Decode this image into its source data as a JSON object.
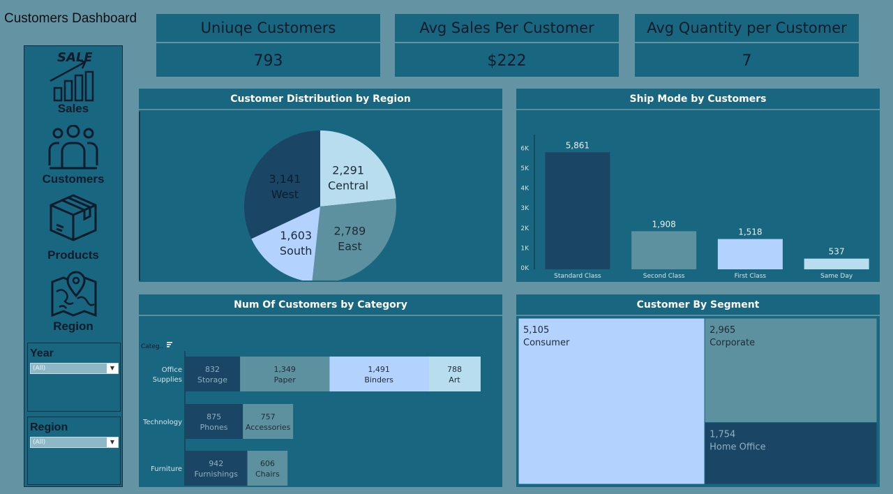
{
  "title": "Customers Dashboard",
  "kpis": [
    {
      "label": "Uniuqe Customers",
      "value": "793"
    },
    {
      "label": "Avg Sales Per Customer",
      "value": "$222"
    },
    {
      "label": "Avg Quantity per Customer",
      "value": "7"
    }
  ],
  "nav": {
    "sales_badge": "SALE",
    "items": [
      "Sales",
      "Customers",
      "Products",
      "Region"
    ]
  },
  "filters": [
    {
      "label": "Year",
      "value": "(All)"
    },
    {
      "label": "Region",
      "value": "(All)"
    }
  ],
  "colors": {
    "dark": "#1b4565",
    "mid": "#5e91a0",
    "light": "#b7ddee",
    "pale": "#b3d2fe",
    "panel": "#18667f"
  },
  "charts": {
    "region": {
      "title": "Customer Distribution by Region",
      "chart_data": {
        "type": "pie",
        "slices": [
          {
            "label": "Central",
            "value": 2291,
            "display": "2,291",
            "color": "#b7ddee"
          },
          {
            "label": "East",
            "value": 2789,
            "display": "2,789",
            "color": "#5e91a0"
          },
          {
            "label": "South",
            "value": 1603,
            "display": "1,603",
            "color": "#b3d2fe"
          },
          {
            "label": "West",
            "value": 3141,
            "display": "3,141",
            "color": "#1b4565"
          }
        ]
      }
    },
    "shipmode": {
      "title": "Ship Mode by Customers",
      "chart_data": {
        "type": "bar",
        "categories": [
          "Standard Class",
          "Second Class",
          "First Class",
          "Same Day"
        ],
        "values": [
          5861,
          1908,
          1518,
          537
        ],
        "labels": [
          "5,861",
          "1,908",
          "1,518",
          "537"
        ],
        "colors": [
          "#1b4565",
          "#5e91a0",
          "#b3d2fe",
          "#b7ddee"
        ],
        "yticks": [
          "0K",
          "1K",
          "2K",
          "3K",
          "4K",
          "5K",
          "6K"
        ],
        "ylim": [
          0,
          6500
        ]
      }
    },
    "category": {
      "title": "Num Of Customers by Category",
      "axis_header": "Categ..",
      "chart_data": {
        "type": "bar",
        "orientation": "horizontal-stacked",
        "xticks": [
          "0",
          "500",
          "1000",
          "1500",
          "2000",
          "2500",
          "3000",
          "3500",
          "4000",
          "4500"
        ],
        "xlim": [
          0,
          4650
        ],
        "categories": [
          {
            "name": "Office\nSupplies",
            "segments": [
              {
                "label": "Storage",
                "value": 832,
                "display": "832",
                "color": "#1b4565"
              },
              {
                "label": "Paper",
                "value": 1349,
                "display": "1,349",
                "color": "#5e91a0"
              },
              {
                "label": "Binders",
                "value": 1491,
                "display": "1,491",
                "color": "#b3d2fe"
              },
              {
                "label": "Art",
                "value": 788,
                "display": "788",
                "color": "#b7ddee"
              }
            ]
          },
          {
            "name": "Technology",
            "segments": [
              {
                "label": "Phones",
                "value": 875,
                "display": "875",
                "color": "#1b4565"
              },
              {
                "label": "Accessories",
                "value": 757,
                "display": "757",
                "color": "#5e91a0"
              }
            ]
          },
          {
            "name": "Furniture",
            "segments": [
              {
                "label": "Furnishings",
                "value": 942,
                "display": "942",
                "color": "#1b4565"
              },
              {
                "label": "Chairs",
                "value": 606,
                "display": "606",
                "color": "#5e91a0"
              }
            ]
          }
        ]
      }
    },
    "segment": {
      "title": "Customer By Segment",
      "chart_data": {
        "type": "treemap",
        "items": [
          {
            "label": "Consumer",
            "value": 5105,
            "display": "5,105",
            "color": "#b3d2fe"
          },
          {
            "label": "Corporate",
            "value": 2965,
            "display": "2,965",
            "color": "#5e91a0"
          },
          {
            "label": "Home Office",
            "value": 1754,
            "display": "1,754",
            "color": "#1b4565"
          }
        ]
      }
    }
  }
}
